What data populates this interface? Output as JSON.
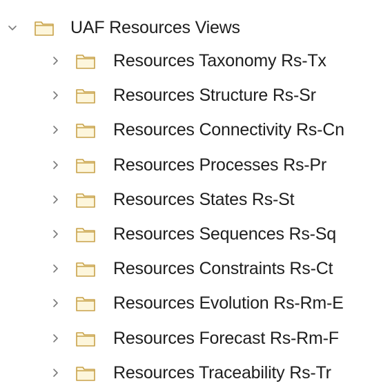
{
  "tree": {
    "root": {
      "label": "UAF Resources Views",
      "expanded": true,
      "twisty_icon": "chevron-down-icon",
      "folder_icon": "folder-icon"
    },
    "children": [
      {
        "label": "Resources Taxonomy Rs-Tx",
        "expanded": false
      },
      {
        "label": "Resources Structure Rs-Sr",
        "expanded": false
      },
      {
        "label": "Resources Connectivity Rs-Cn",
        "expanded": false
      },
      {
        "label": "Resources Processes Rs-Pr",
        "expanded": false
      },
      {
        "label": "Resources States Rs-St",
        "expanded": false
      },
      {
        "label": "Resources Sequences Rs-Sq",
        "expanded": false
      },
      {
        "label": "Resources Constraints Rs-Ct",
        "expanded": false
      },
      {
        "label": "Resources Evolution Rs-Rm-E",
        "expanded": false
      },
      {
        "label": "Resources Forecast Rs-Rm-F",
        "expanded": false
      },
      {
        "label": "Resources Traceability Rs-Tr",
        "expanded": false
      }
    ],
    "colors": {
      "folder_stroke": "#c8a24a",
      "folder_fill": "#fdf6dc",
      "chevron": "#7a7a7a",
      "text": "#1e1e1e"
    }
  }
}
